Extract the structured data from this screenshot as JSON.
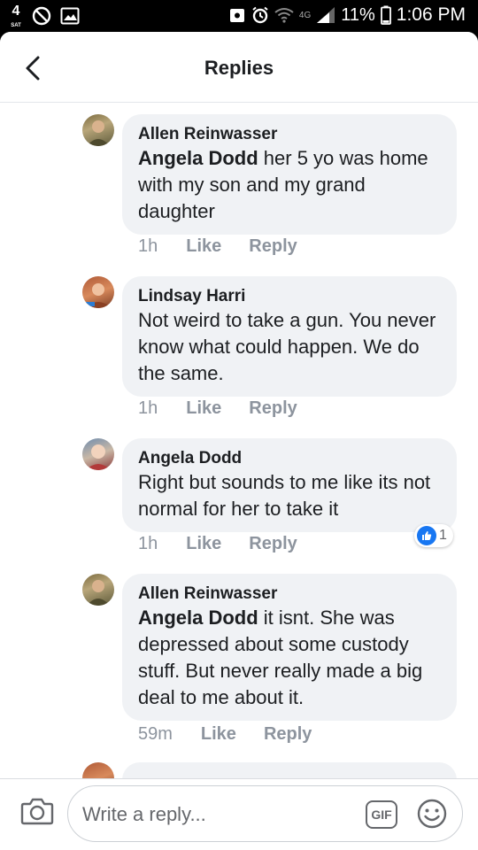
{
  "status_bar": {
    "date_day": "4",
    "date_weekday": "SAT",
    "network": "4G",
    "battery": "11%",
    "time": "1:06 PM"
  },
  "header": {
    "title": "Replies"
  },
  "comments": [
    {
      "author": "Allen Reinwasser",
      "mention": "Angela Dodd",
      "text": " her 5 yo was home with my son and my grand daughter",
      "time": "1h",
      "like": "Like",
      "reply": "Reply"
    },
    {
      "author": "Lindsay Harri",
      "mention": "",
      "text": "Not weird to take a gun.  You never know what could happen. We do the same.",
      "time": "1h",
      "like": "Like",
      "reply": "Reply"
    },
    {
      "author": "Angela Dodd",
      "mention": "",
      "text": "Right but sounds to me like its not normal for her to take it",
      "time": "1h",
      "like": "Like",
      "reply": "Reply",
      "reaction_count": "1"
    },
    {
      "author": "Allen Reinwasser",
      "mention": "Angela Dodd",
      "text": " it isnt.  She was depressed about some custody stuff.  But never really made a big deal to me about it.",
      "time": "59m",
      "like": "Like",
      "reply": "Reply"
    }
  ],
  "composer": {
    "placeholder": "Write a reply...",
    "gif_label": "GIF"
  },
  "colors": {
    "accent": "#1877f2",
    "bubble": "#f0f2f5",
    "text": "#1c1e21",
    "meta": "#8d949e"
  },
  "icons": [
    "back-arrow-icon",
    "camera-icon",
    "gif-icon",
    "emoji-icon",
    "like-thumb-icon"
  ]
}
